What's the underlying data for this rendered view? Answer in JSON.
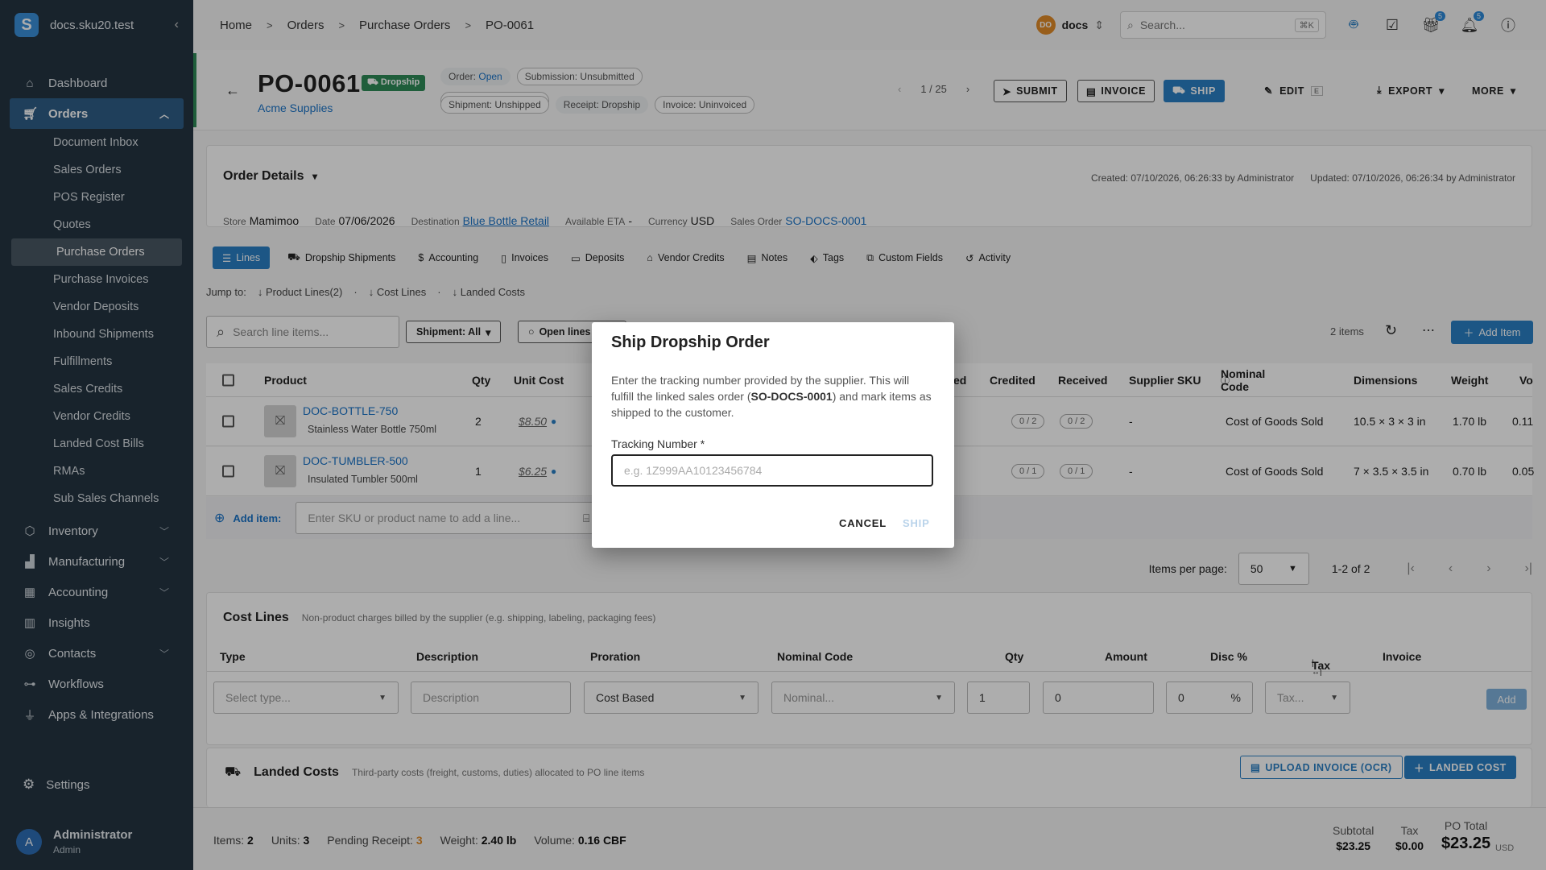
{
  "sidebar": {
    "workspace": "docs.sku20.test",
    "logo_letter": "S",
    "nav": [
      {
        "label": "Dashboard",
        "icon": "home-icon"
      },
      {
        "label": "Orders",
        "icon": "cart-icon"
      },
      {
        "label": "Document Inbox"
      },
      {
        "label": "Sales Orders"
      },
      {
        "label": "POS Register"
      },
      {
        "label": "Quotes"
      },
      {
        "label": "Purchase Orders"
      },
      {
        "label": "Purchase Invoices"
      },
      {
        "label": "Vendor Deposits"
      },
      {
        "label": "Inbound Shipments"
      },
      {
        "label": "Fulfillments"
      },
      {
        "label": "Sales Credits"
      },
      {
        "label": "Vendor Credits"
      },
      {
        "label": "Landed Cost Bills"
      },
      {
        "label": "RMAs"
      },
      {
        "label": "Sub Sales Channels"
      },
      {
        "label": "Inventory",
        "icon": "box-icon"
      },
      {
        "label": "Manufacturing",
        "icon": "factory-icon"
      },
      {
        "label": "Accounting",
        "icon": "calculator-icon"
      },
      {
        "label": "Insights",
        "icon": "chart-icon"
      },
      {
        "label": "Contacts",
        "icon": "contacts-icon"
      },
      {
        "label": "Workflows",
        "icon": "workflow-icon"
      },
      {
        "label": "Apps & Integrations",
        "icon": "plug-icon"
      }
    ],
    "settings": "Settings",
    "user": {
      "initial": "A",
      "name": "Administrator",
      "role": "Admin"
    }
  },
  "topbar": {
    "breadcrumb": [
      "Home",
      "Orders",
      "Purchase Orders",
      "PO-0061"
    ],
    "workspace_badge": "DO",
    "workspace_name": "docs",
    "search_placeholder": "Search...",
    "search_shortcut": "⌘K",
    "gift_count": "5",
    "notif_count": "5"
  },
  "header": {
    "po_number": "PO-0061",
    "type_badge": "Dropship",
    "vendor": "Acme Supplies",
    "chips": {
      "order_label": "Order:",
      "order_value": "Open",
      "submission": "Submission: Unsubmitted",
      "shipment": "Shipment: Unshipped",
      "receipt": "Receipt: Dropship",
      "invoice": "Invoice: Uninvoiced"
    },
    "pager": "1 / 25",
    "buttons": {
      "submit": "SUBMIT",
      "invoice": "INVOICE",
      "ship": "SHIP",
      "edit": "EDIT",
      "export": "EXPORT",
      "more": "MORE"
    }
  },
  "order_details": {
    "title": "Order Details",
    "created": "Created: 07/10/2026, 06:26:33 by Administrator",
    "updated": "Updated: 07/10/2026, 06:26:34 by Administrator",
    "fields": {
      "store_label": "Store",
      "store": "Mamimoo",
      "date_label": "Date",
      "date": "07/06/2026",
      "destination_label": "Destination",
      "destination": "Blue Bottle Retail",
      "eta_label": "Available ETA",
      "eta": "-",
      "currency_label": "Currency",
      "currency": "USD",
      "so_label": "Sales Order",
      "so": "SO-DOCS-0001"
    }
  },
  "tabs": [
    "Lines",
    "Dropship Shipments",
    "Accounting",
    "Invoices",
    "Deposits",
    "Vendor Credits",
    "Notes",
    "Tags",
    "Custom Fields",
    "Activity"
  ],
  "jump": {
    "label": "Jump to:",
    "links": [
      "Product Lines(2)",
      "Cost Lines",
      "Landed Costs"
    ]
  },
  "lines_toolbar": {
    "search_placeholder": "Search line items...",
    "shipment_filter": "Shipment: All",
    "open_lines": "Open lines",
    "count": "2 items",
    "add_item": "Add Item"
  },
  "lines_table": {
    "headers": {
      "product": "Product",
      "qty": "Qty",
      "unit_cost": "Unit Cost",
      "received_partial": "ed",
      "credited": "Credited",
      "received": "Received",
      "supplier_sku": "Supplier SKU",
      "nominal": "Nominal Code",
      "dimensions": "Dimensions",
      "weight": "Weight",
      "volume": "Vo"
    },
    "rows": [
      {
        "sku": "DOC-BOTTLE-750",
        "name": "Stainless Water Bottle 750ml",
        "qty": "2",
        "unit_cost": "$8.50",
        "credited": "0 / 2",
        "received": "0 / 2",
        "supplier_sku": "-",
        "nominal": "Cost of Goods Sold",
        "dimensions": "10.5 × 3 × 3 in",
        "weight": "1.70 lb",
        "volume": "0.11"
      },
      {
        "sku": "DOC-TUMBLER-500",
        "name": "Insulated Tumbler 500ml",
        "qty": "1",
        "unit_cost": "$6.25",
        "credited": "0 / 1",
        "received": "0 / 1",
        "supplier_sku": "-",
        "nominal": "Cost of Goods Sold",
        "dimensions": "7 × 3.5 × 3.5 in",
        "weight": "0.70 lb",
        "volume": "0.05"
      }
    ],
    "add_item_label": "Add item:",
    "add_item_placeholder": "Enter SKU or product name to add a line..."
  },
  "pagination": {
    "label": "Items per page:",
    "per_page": "50",
    "range": "1-2 of 2"
  },
  "cost_lines": {
    "title": "Cost Lines",
    "subtitle": "Non-product charges billed by the supplier (e.g. shipping, labeling, packaging fees)",
    "headers": {
      "type": "Type",
      "description": "Description",
      "proration": "Proration",
      "nominal": "Nominal Code",
      "qty": "Qty",
      "amount": "Amount",
      "disc": "Disc %",
      "tax": "Tax",
      "invoice": "Invoice"
    },
    "inputs": {
      "type": "Select type...",
      "description": "Description",
      "proration": "Cost Based",
      "nominal": "Nominal...",
      "qty": "1",
      "amount": "0",
      "disc": "0",
      "disc_unit": "%",
      "tax": "Tax..."
    },
    "add": "Add"
  },
  "landed_costs": {
    "title": "Landed Costs",
    "subtitle": "Third-party costs (freight, customs, duties) allocated to PO line items",
    "upload": "UPLOAD INVOICE (OCR)",
    "add": "LANDED COST"
  },
  "footer": {
    "items_label": "Items:",
    "items": "2",
    "units_label": "Units:",
    "units": "3",
    "pending_label": "Pending Receipt:",
    "pending": "3",
    "weight_label": "Weight:",
    "weight": "2.40 lb",
    "volume_label": "Volume:",
    "volume": "0.16 CBF",
    "subtotal_label": "Subtotal",
    "subtotal": "$23.25",
    "tax_label": "Tax",
    "tax": "$0.00",
    "total_label": "PO Total",
    "total": "$23.25",
    "currency": "USD"
  },
  "dialog": {
    "title": "Ship Dropship Order",
    "text_1": "Enter the tracking number provided by the supplier. This will fulfill the linked sales order (",
    "text_so": "SO-DOCS-0001",
    "text_2": ") and mark items as shipped to the customer.",
    "label": "Tracking Number *",
    "placeholder": "e.g. 1Z999AA10123456784",
    "cancel": "CANCEL",
    "ship": "SHIP"
  },
  "colors": {
    "sidebar": "#243442",
    "accent": "#2a7fc4",
    "dropship": "#2e8b57",
    "pending": "#e08b28"
  }
}
